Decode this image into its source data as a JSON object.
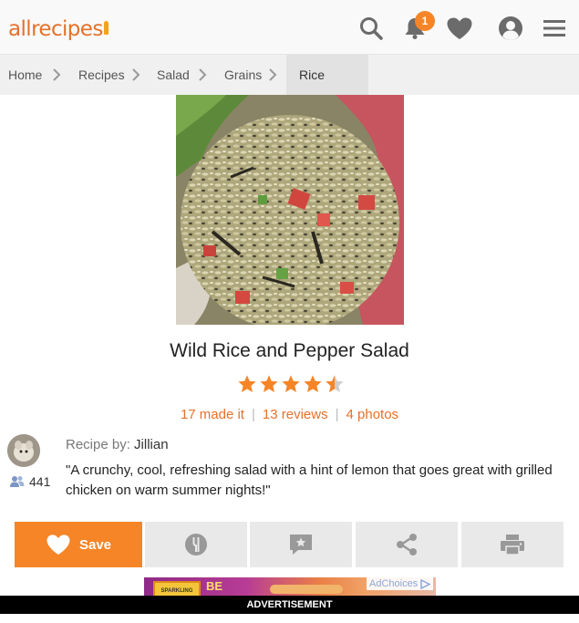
{
  "header": {
    "logo_text": "allrecipes",
    "notification_count": "1",
    "accent_color": "#f68527",
    "icons": [
      "search-icon",
      "bell-icon",
      "heart-icon",
      "user-icon",
      "menu-icon"
    ]
  },
  "breadcrumb": {
    "items": [
      "Home",
      "Recipes",
      "Salad",
      "Grains",
      "Rice Salad"
    ]
  },
  "recipe": {
    "title": "Wild Rice and Pepper Salad",
    "rating": 4.5,
    "rating_max": 5,
    "made_it": "17 made it",
    "reviews": "13 reviews",
    "photos": "4 photos",
    "author_label": "Recipe by:",
    "author_name": "Jillian",
    "followers": "441",
    "description": "\"A crunchy, cool, refreshing salad with a hint of lemon that goes great with grilled chicken on warm summer nights!\""
  },
  "actions": {
    "save_label": "Save",
    "items": [
      "save-button",
      "made-it-button",
      "review-button",
      "share-button",
      "print-button"
    ]
  },
  "ad": {
    "choices_label": "AdChoices",
    "banner_label": "ADVERTISEMENT",
    "banner_text": "BE",
    "banner_badge": "SPARKLING"
  }
}
